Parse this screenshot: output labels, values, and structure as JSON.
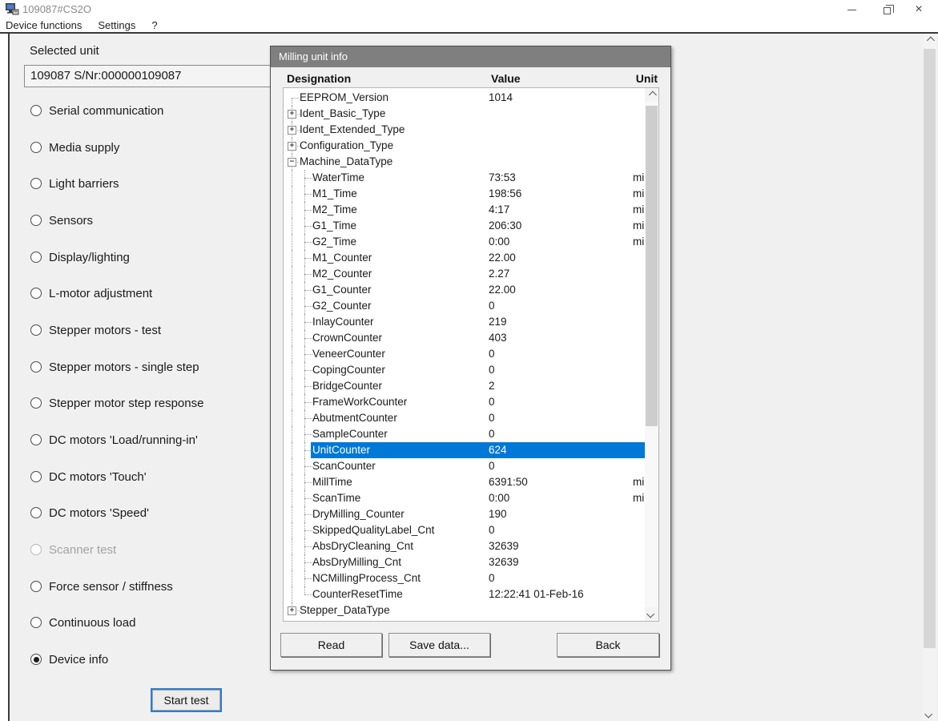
{
  "window": {
    "title": "109087#CS2O",
    "controls": {
      "minimize": "minimize",
      "restore": "restore",
      "close": "close"
    }
  },
  "menu": {
    "items": [
      {
        "label": "Device functions"
      },
      {
        "label": "Settings"
      },
      {
        "label": "?"
      }
    ]
  },
  "sidebar": {
    "selected_unit_label": "Selected unit",
    "selected_unit_value": "109087 S/Nr:000000109087",
    "start_test_label": "Start test",
    "options": [
      {
        "label": "Serial communication",
        "selected": false,
        "enabled": true
      },
      {
        "label": "Media supply",
        "selected": false,
        "enabled": true
      },
      {
        "label": "Light barriers",
        "selected": false,
        "enabled": true
      },
      {
        "label": "Sensors",
        "selected": false,
        "enabled": true
      },
      {
        "label": "Display/lighting",
        "selected": false,
        "enabled": true
      },
      {
        "label": "L-motor adjustment",
        "selected": false,
        "enabled": true
      },
      {
        "label": "Stepper motors - test",
        "selected": false,
        "enabled": true
      },
      {
        "label": "Stepper motors - single step",
        "selected": false,
        "enabled": true
      },
      {
        "label": "Stepper motor step response",
        "selected": false,
        "enabled": true
      },
      {
        "label": "DC motors 'Load/running-in'",
        "selected": false,
        "enabled": true
      },
      {
        "label": "DC motors 'Touch'",
        "selected": false,
        "enabled": true
      },
      {
        "label": "DC motors 'Speed'",
        "selected": false,
        "enabled": true
      },
      {
        "label": "Scanner test",
        "selected": false,
        "enabled": false
      },
      {
        "label": "Force sensor / stiffness",
        "selected": false,
        "enabled": true
      },
      {
        "label": "Continuous load",
        "selected": false,
        "enabled": true
      },
      {
        "label": "Device info",
        "selected": true,
        "enabled": true
      }
    ]
  },
  "dialog": {
    "title": "Milling unit info",
    "columns": [
      "Designation",
      "Value",
      "Unit"
    ],
    "buttons": [
      {
        "label": "Read"
      },
      {
        "label": "Save data..."
      },
      {
        "label": "Back"
      }
    ],
    "rows": [
      {
        "name": "EEPROM_Version",
        "value": "1014",
        "unit": "",
        "depth": 0,
        "expand": null,
        "selected": false
      },
      {
        "name": "Ident_Basic_Type",
        "value": "",
        "unit": "",
        "depth": 0,
        "expand": "+",
        "selected": false
      },
      {
        "name": "Ident_Extended_Type",
        "value": "",
        "unit": "",
        "depth": 0,
        "expand": "+",
        "selected": false
      },
      {
        "name": "Configuration_Type",
        "value": "",
        "unit": "",
        "depth": 0,
        "expand": "+",
        "selected": false
      },
      {
        "name": "Machine_DataType",
        "value": "",
        "unit": "",
        "depth": 0,
        "expand": "-",
        "selected": false
      },
      {
        "name": "WaterTime",
        "value": "73:53",
        "unit": "mi",
        "depth": 1,
        "expand": null,
        "selected": false
      },
      {
        "name": "M1_Time",
        "value": "198:56",
        "unit": "mi",
        "depth": 1,
        "expand": null,
        "selected": false
      },
      {
        "name": "M2_Time",
        "value": "4:17",
        "unit": "mi",
        "depth": 1,
        "expand": null,
        "selected": false
      },
      {
        "name": "G1_Time",
        "value": "206:30",
        "unit": "mi",
        "depth": 1,
        "expand": null,
        "selected": false
      },
      {
        "name": "G2_Time",
        "value": "0:00",
        "unit": "mi",
        "depth": 1,
        "expand": null,
        "selected": false
      },
      {
        "name": "M1_Counter",
        "value": "22.00",
        "unit": "",
        "depth": 1,
        "expand": null,
        "selected": false
      },
      {
        "name": "M2_Counter",
        "value": "2.27",
        "unit": "",
        "depth": 1,
        "expand": null,
        "selected": false
      },
      {
        "name": "G1_Counter",
        "value": "22.00",
        "unit": "",
        "depth": 1,
        "expand": null,
        "selected": false
      },
      {
        "name": "G2_Counter",
        "value": "0",
        "unit": "",
        "depth": 1,
        "expand": null,
        "selected": false
      },
      {
        "name": "InlayCounter",
        "value": "219",
        "unit": "",
        "depth": 1,
        "expand": null,
        "selected": false
      },
      {
        "name": "CrownCounter",
        "value": "403",
        "unit": "",
        "depth": 1,
        "expand": null,
        "selected": false
      },
      {
        "name": "VeneerCounter",
        "value": "0",
        "unit": "",
        "depth": 1,
        "expand": null,
        "selected": false
      },
      {
        "name": "CopingCounter",
        "value": "0",
        "unit": "",
        "depth": 1,
        "expand": null,
        "selected": false
      },
      {
        "name": "BridgeCounter",
        "value": "2",
        "unit": "",
        "depth": 1,
        "expand": null,
        "selected": false
      },
      {
        "name": "FrameWorkCounter",
        "value": "0",
        "unit": "",
        "depth": 1,
        "expand": null,
        "selected": false
      },
      {
        "name": "AbutmentCounter",
        "value": "0",
        "unit": "",
        "depth": 1,
        "expand": null,
        "selected": false
      },
      {
        "name": "SampleCounter",
        "value": "0",
        "unit": "",
        "depth": 1,
        "expand": null,
        "selected": false
      },
      {
        "name": "UnitCounter",
        "value": "624",
        "unit": "",
        "depth": 1,
        "expand": null,
        "selected": true
      },
      {
        "name": "ScanCounter",
        "value": "0",
        "unit": "",
        "depth": 1,
        "expand": null,
        "selected": false
      },
      {
        "name": "MillTime",
        "value": "6391:50",
        "unit": "mi",
        "depth": 1,
        "expand": null,
        "selected": false
      },
      {
        "name": "ScanTime",
        "value": "0:00",
        "unit": "mi",
        "depth": 1,
        "expand": null,
        "selected": false
      },
      {
        "name": "DryMilling_Counter",
        "value": "190",
        "unit": "",
        "depth": 1,
        "expand": null,
        "selected": false
      },
      {
        "name": "SkippedQualityLabel_Cnt",
        "value": "0",
        "unit": "",
        "depth": 1,
        "expand": null,
        "selected": false
      },
      {
        "name": "AbsDryCleaning_Cnt",
        "value": "32639",
        "unit": "",
        "depth": 1,
        "expand": null,
        "selected": false
      },
      {
        "name": "AbsDryMilling_Cnt",
        "value": "32639",
        "unit": "",
        "depth": 1,
        "expand": null,
        "selected": false
      },
      {
        "name": "NCMillingProcess_Cnt",
        "value": "0",
        "unit": "",
        "depth": 1,
        "expand": null,
        "selected": false
      },
      {
        "name": "CounterResetTime",
        "value": "12:22:41 01-Feb-16",
        "unit": "",
        "depth": 1,
        "expand": null,
        "selected": false,
        "last_child": true
      },
      {
        "name": "Stepper_DataType",
        "value": "",
        "unit": "",
        "depth": 0,
        "expand": "+",
        "selected": false
      }
    ]
  },
  "colors": {
    "selection": "#0078d7",
    "dialog_titlebar": "#7f7f7f",
    "focus_ring": "#2f7ccb",
    "panel_bg": "#f0f0f0"
  }
}
